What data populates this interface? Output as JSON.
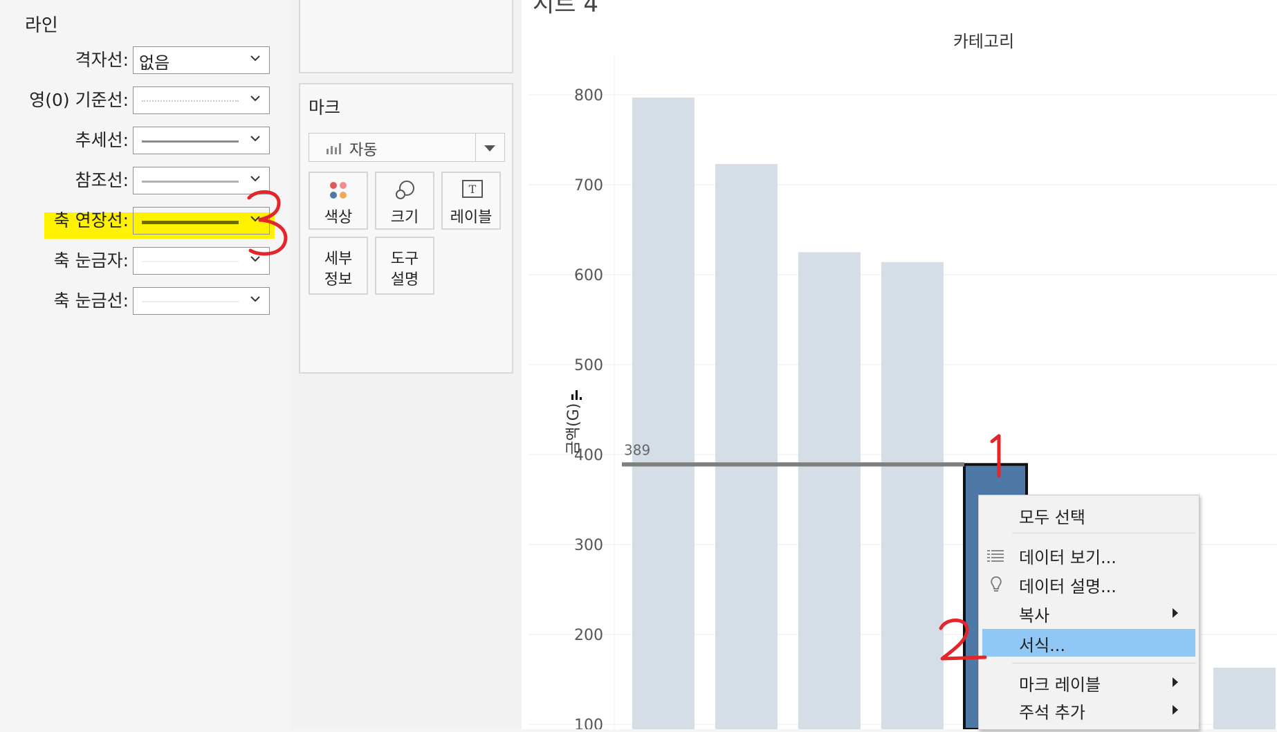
{
  "format_pane": {
    "section_title": "라인",
    "rows": [
      {
        "label": "격자선:",
        "value": "없음"
      },
      {
        "label": "영(0) 기준선:",
        "value": ""
      },
      {
        "label": "추세선:",
        "value": ""
      },
      {
        "label": "참조선:",
        "value": ""
      },
      {
        "label": "축 연장선:",
        "value": ""
      },
      {
        "label": "축 눈금자:",
        "value": ""
      },
      {
        "label": "축 눈금선:",
        "value": ""
      }
    ],
    "highlight_color": "#fff200"
  },
  "marks_card": {
    "title": "마크",
    "mark_type": "자동",
    "mark_type_icon": "bar-chart-icon",
    "buttons": [
      {
        "label": "색상",
        "icon": "color-dots-icon"
      },
      {
        "label": "크기",
        "icon": "size-circles-icon"
      },
      {
        "label": "레이블",
        "icon": "text-label-icon"
      },
      {
        "label_line1": "세부",
        "label_line2": "정보"
      },
      {
        "label_line1": "도구",
        "label_line2": "설명"
      }
    ]
  },
  "chart": {
    "sheet_title_partial": "시트 4",
    "header": "카테고리",
    "axis_label": "금액(G)",
    "reference_value_label": "389",
    "colors": {
      "bar": "#d5dde6",
      "selected_bar": "#4e79a7",
      "reference_line": "#7f7f7f"
    }
  },
  "chart_data": {
    "type": "bar",
    "title": "",
    "xlabel": "카테고리",
    "ylabel": "금액(G)",
    "ylim": [
      100,
      800
    ],
    "yticks": [
      100,
      200,
      300,
      400,
      500,
      600,
      700,
      800
    ],
    "values": [
      797,
      723,
      625,
      614,
      389,
      163
    ],
    "selected_index": 4,
    "reference_line": 389,
    "grid": true
  },
  "context_menu": {
    "items": [
      {
        "label": "모두 선택",
        "icon": "",
        "submenu": false,
        "highlighted": false
      },
      {
        "label": "데이터 보기...",
        "icon": "table-grid-icon",
        "submenu": false,
        "highlighted": false
      },
      {
        "label": "데이터 설명...",
        "icon": "lightbulb-icon",
        "submenu": false,
        "highlighted": false
      },
      {
        "label": "복사",
        "icon": "",
        "submenu": true,
        "highlighted": false
      },
      {
        "label": "서식...",
        "icon": "",
        "submenu": false,
        "highlighted": true
      },
      {
        "label": "마크 레이블",
        "icon": "",
        "submenu": true,
        "highlighted": false
      },
      {
        "label": "주석 추가",
        "icon": "",
        "submenu": true,
        "highlighted": false
      }
    ],
    "highlight_color": "#90c7f5"
  },
  "annotations": [
    "1",
    "2",
    "3"
  ]
}
